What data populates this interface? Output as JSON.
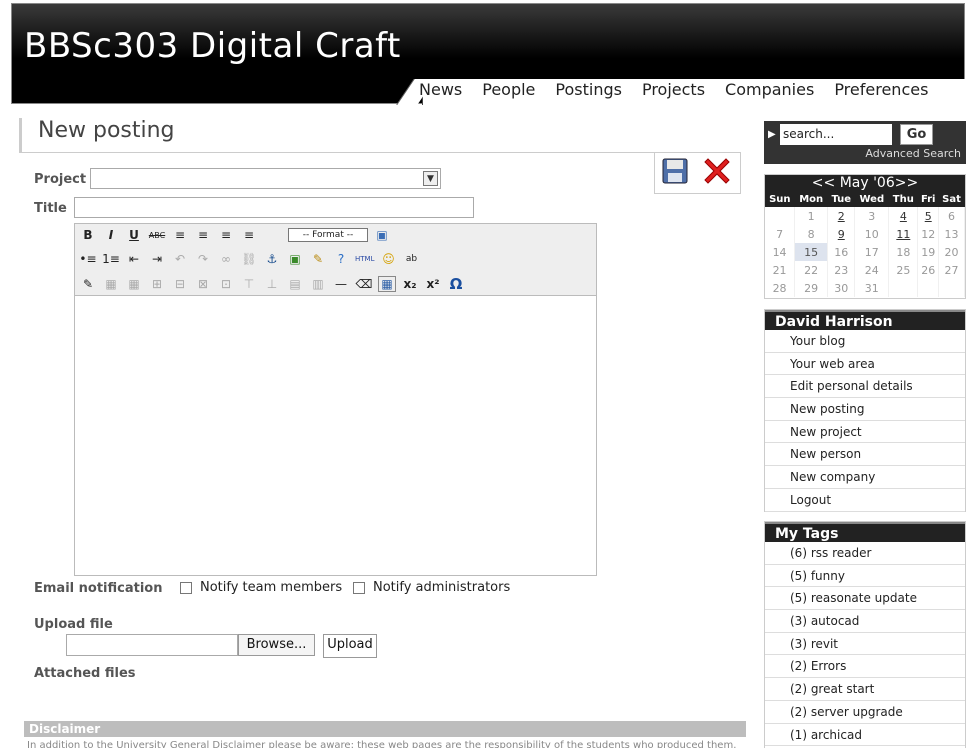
{
  "header": {
    "title": "BBSc303 Digital Craft",
    "nav": [
      "News",
      "People",
      "Postings",
      "Projects",
      "Companies",
      "Preferences"
    ]
  },
  "page": {
    "heading": "New posting"
  },
  "form": {
    "project_label": "Project",
    "title_label": "Title",
    "format_select": "-- Format --",
    "email_label": "Email notification",
    "notify_team": "Notify team members",
    "notify_admins": "Notify administrators",
    "upload_label": "Upload file",
    "browse_button": "Browse...",
    "upload_button": "Upload",
    "attached_label": "Attached files"
  },
  "toolbar": {
    "row1": [
      "B",
      "I",
      "U",
      "ABC",
      "≡",
      "≡",
      "≡",
      "≡"
    ],
    "row2": [
      "•≡",
      "1≡",
      "⇤",
      "⇥",
      "↶",
      "↷",
      "∞",
      "⛓",
      "⚓",
      "▣",
      "✎",
      "?",
      "HTML",
      "☺",
      "ab"
    ],
    "row3": [
      "✎",
      "▦",
      "▦",
      "⊞",
      "⊟",
      "⊠",
      "⊡",
      "⊤",
      "⊥",
      "▤",
      "▥",
      "—",
      "⌫",
      "▦",
      "x₂",
      "x²",
      "Ω"
    ]
  },
  "disclaimer": {
    "title": "Disclaimer",
    "text": "In addition to the University General Disclaimer please be aware: these web pages are the responsibility of the students who produced them. The"
  },
  "search": {
    "value": "search...",
    "go": "Go",
    "advanced": "Advanced Search"
  },
  "calendar": {
    "title": "<< May '06>>",
    "days": [
      "Sun",
      "Mon",
      "Tue",
      "Wed",
      "Thu",
      "Fri",
      "Sat"
    ],
    "weeks": [
      [
        "",
        "1",
        "2",
        "3",
        "4",
        "5",
        "6"
      ],
      [
        "7",
        "8",
        "9",
        "10",
        "11",
        "12",
        "13"
      ],
      [
        "14",
        "15",
        "16",
        "17",
        "18",
        "19",
        "20"
      ],
      [
        "21",
        "22",
        "23",
        "24",
        "25",
        "26",
        "27"
      ],
      [
        "28",
        "29",
        "30",
        "31",
        "",
        "",
        ""
      ]
    ],
    "linked": [
      "2",
      "4",
      "5",
      "9",
      "11"
    ],
    "today": "15"
  },
  "user_box": {
    "name": "David Harrison",
    "items": [
      "Your blog",
      "Your web area",
      "Edit personal details",
      "New posting",
      "New project",
      "New person",
      "New company",
      "Logout"
    ]
  },
  "tags_box": {
    "title": "My Tags",
    "items": [
      "(6) rss reader",
      "(5) funny",
      "(5) reasonate update",
      "(3) autocad",
      "(3) revit",
      "(2) Errors",
      "(2) great start",
      "(2) server upgrade",
      "(1) archicad"
    ]
  },
  "colors": {
    "header_bg": "#000000",
    "sidebar_header": "#222222",
    "disclaimer_bar": "#bdbdbd"
  }
}
